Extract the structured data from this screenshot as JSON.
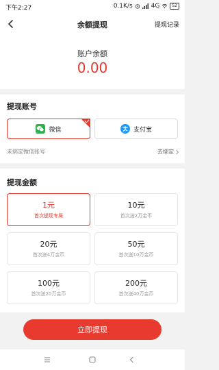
{
  "status": {
    "time": "下午2:27",
    "speed": "0.1K/s",
    "network": "4G",
    "battery": "52"
  },
  "header": {
    "title": "余额提现",
    "right_label": "提现记录"
  },
  "balance": {
    "label": "账户余额",
    "value": "0.00"
  },
  "account": {
    "title": "提现账号",
    "options": [
      {
        "label": "微信",
        "icon": "wechat-icon",
        "selected": true
      },
      {
        "label": "支付宝",
        "icon": "alipay-icon",
        "selected": false
      }
    ],
    "unbound_text": "未绑定微信账号",
    "bind_label": "去绑定"
  },
  "amount": {
    "title": "提现金额",
    "items": [
      {
        "value": "1元",
        "desc": "首次提现专属",
        "selected": true
      },
      {
        "value": "10元",
        "desc": "首次送2万金币",
        "selected": false
      },
      {
        "value": "20元",
        "desc": "首次送4万金币",
        "selected": false
      },
      {
        "value": "50元",
        "desc": "首次送10万金币",
        "selected": false
      },
      {
        "value": "100元",
        "desc": "首次送20万金币",
        "selected": false
      },
      {
        "value": "200元",
        "desc": "首次送40万金币",
        "selected": false
      }
    ]
  },
  "action": {
    "withdraw_label": "立即提现"
  },
  "colors": {
    "accent": "#e5392e",
    "wechat": "#2bb24c",
    "alipay": "#1a9bff"
  }
}
